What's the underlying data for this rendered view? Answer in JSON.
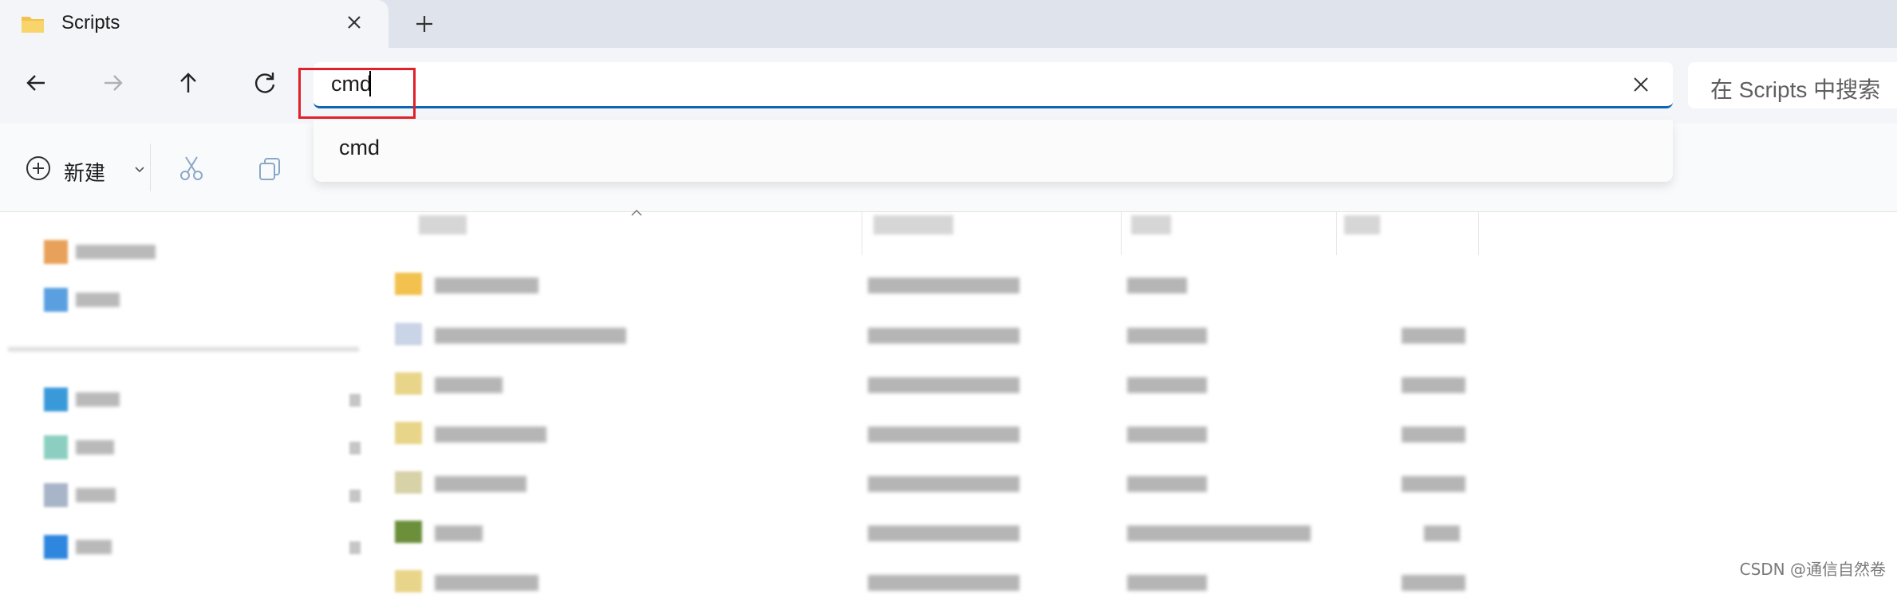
{
  "tab": {
    "title": "Scripts",
    "folder_icon": "folder-icon",
    "close_icon": "close-icon"
  },
  "new_tab_icon": "plus-icon",
  "nav": {
    "back_icon": "arrow-left-icon",
    "forward_icon": "arrow-right-icon",
    "up_icon": "arrow-up-icon",
    "refresh_icon": "refresh-icon"
  },
  "address": {
    "value": "cmd",
    "clear_icon": "close-icon"
  },
  "search": {
    "placeholder": "在 Scripts 中搜索"
  },
  "dropdown": {
    "suggestions": [
      "cmd"
    ]
  },
  "commandbar": {
    "new_label": "新建",
    "new_icon": "circle-plus-icon",
    "cut_icon": "scissors-icon",
    "copy_icon": "copy-icon"
  },
  "watermark": "CSDN @通信自然卷",
  "colors": {
    "accent": "#0f64b3",
    "highlight_box": "#e0202a",
    "folder": "#f2c14e"
  }
}
